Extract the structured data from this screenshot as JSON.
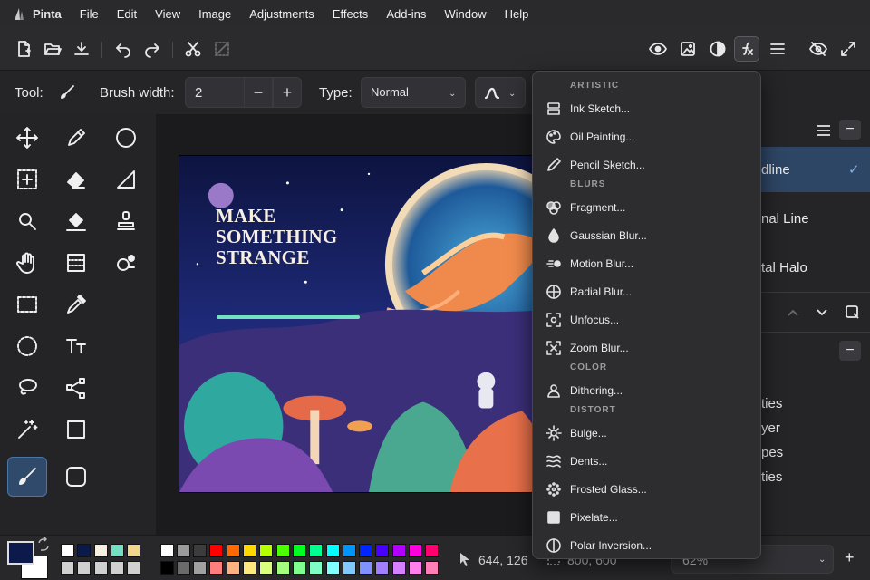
{
  "app": {
    "name": "Pinta"
  },
  "menubar": {
    "items": [
      "File",
      "Edit",
      "View",
      "Image",
      "Adjustments",
      "Effects",
      "Add-ins",
      "Window",
      "Help"
    ]
  },
  "toolbar": {
    "icons": [
      "new-image-icon",
      "open-icon",
      "save-icon",
      "undo-icon",
      "redo-icon",
      "cut-icon",
      "crop-to-selection-icon",
      "view-icon",
      "image-icon",
      "adjustments-icon",
      "effects-icon",
      "main-menu-icon",
      "hide-icon",
      "fullscreen-icon"
    ]
  },
  "tool_options": {
    "tool_label": "Tool:",
    "brush_width_label": "Brush width:",
    "brush_width_value": "2",
    "minus": "−",
    "plus": "+",
    "type_label": "Type:",
    "type_value": "Normal"
  },
  "tools": [
    "move-selected",
    "pencil",
    "ellipse",
    "move-selection",
    "eraser",
    "freeform-shape",
    "zoom",
    "paint-bucket",
    "clone-stamp",
    "pan",
    "gradient",
    "recolor",
    "rectangle-select",
    "color-picker",
    "ellipse-select",
    "text",
    "lasso-select",
    "line-curve",
    "magic-wand",
    "rectangle",
    "paintbrush",
    "rounded-rectangle"
  ],
  "canvas": {
    "title_text": "MAKE\nSOMETHING\nSTRANGE"
  },
  "right_panel": {
    "items": [
      "dline",
      "nal Line",
      "tal Halo"
    ],
    "check": "✓",
    "props": [
      "ties",
      "yer",
      "pes",
      "ties"
    ],
    "minus": "−"
  },
  "effects_menu": {
    "sections": [
      {
        "header": "ARTISTIC",
        "items": [
          {
            "label": "Ink Sketch...",
            "icon": "ink-sketch-icon"
          },
          {
            "label": "Oil Painting...",
            "icon": "oil-painting-icon"
          },
          {
            "label": "Pencil Sketch...",
            "icon": "pencil-sketch-icon"
          }
        ]
      },
      {
        "header": "BLURS",
        "items": [
          {
            "label": "Fragment...",
            "icon": "fragment-icon"
          },
          {
            "label": "Gaussian Blur...",
            "icon": "gaussian-blur-icon"
          },
          {
            "label": "Motion Blur...",
            "icon": "motion-blur-icon"
          },
          {
            "label": "Radial Blur...",
            "icon": "radial-blur-icon"
          },
          {
            "label": "Unfocus...",
            "icon": "unfocus-icon"
          },
          {
            "label": "Zoom Blur...",
            "icon": "zoom-blur-icon"
          }
        ]
      },
      {
        "header": "COLOR",
        "items": [
          {
            "label": "Dithering...",
            "icon": "dithering-icon"
          }
        ]
      },
      {
        "header": "DISTORT",
        "items": [
          {
            "label": "Bulge...",
            "icon": "bulge-icon"
          },
          {
            "label": "Dents...",
            "icon": "dents-icon"
          },
          {
            "label": "Frosted Glass...",
            "icon": "frosted-glass-icon"
          },
          {
            "label": "Pixelate...",
            "icon": "pixelate-icon"
          },
          {
            "label": "Polar Inversion...",
            "icon": "polar-inversion-icon"
          }
        ]
      }
    ]
  },
  "status": {
    "cursor_position": "644, 126",
    "selection_size": "800, 600",
    "zoom": "62%"
  },
  "colors": {
    "primary": "#0b1a4a",
    "secondary": "#ffffff",
    "accent": "#2f4a6b",
    "palette_row1": [
      "#ffffff",
      "#0b1a4a",
      "#f6efe2",
      "#73e0c4",
      "#f4d58d",
      "#ffffff",
      "#9a9a9a",
      "#3c3c3c",
      "#ff0000",
      "#ff6a00",
      "#ffd800",
      "#b6ff00",
      "#4cff00",
      "#00ff21",
      "#00ff90",
      "#00ffff",
      "#0094ff",
      "#0026ff",
      "#4800ff",
      "#b200ff",
      "#ff00dc",
      "#ff006e"
    ],
    "palette_row2": [
      "#d0d0d0",
      "#d0d0d0",
      "#d0d0d0",
      "#d0d0d0",
      "#d0d0d0",
      "#000000",
      "#6a6a6a",
      "#a0a0a0",
      "#ff7f7f",
      "#ffb27f",
      "#ffe97f",
      "#daff7f",
      "#a5ff7f",
      "#7fff8e",
      "#7fffc5",
      "#7fffff",
      "#7fc9ff",
      "#7f92ff",
      "#a17fff",
      "#d67fff",
      "#ff7fed",
      "#ff7fb6"
    ]
  }
}
